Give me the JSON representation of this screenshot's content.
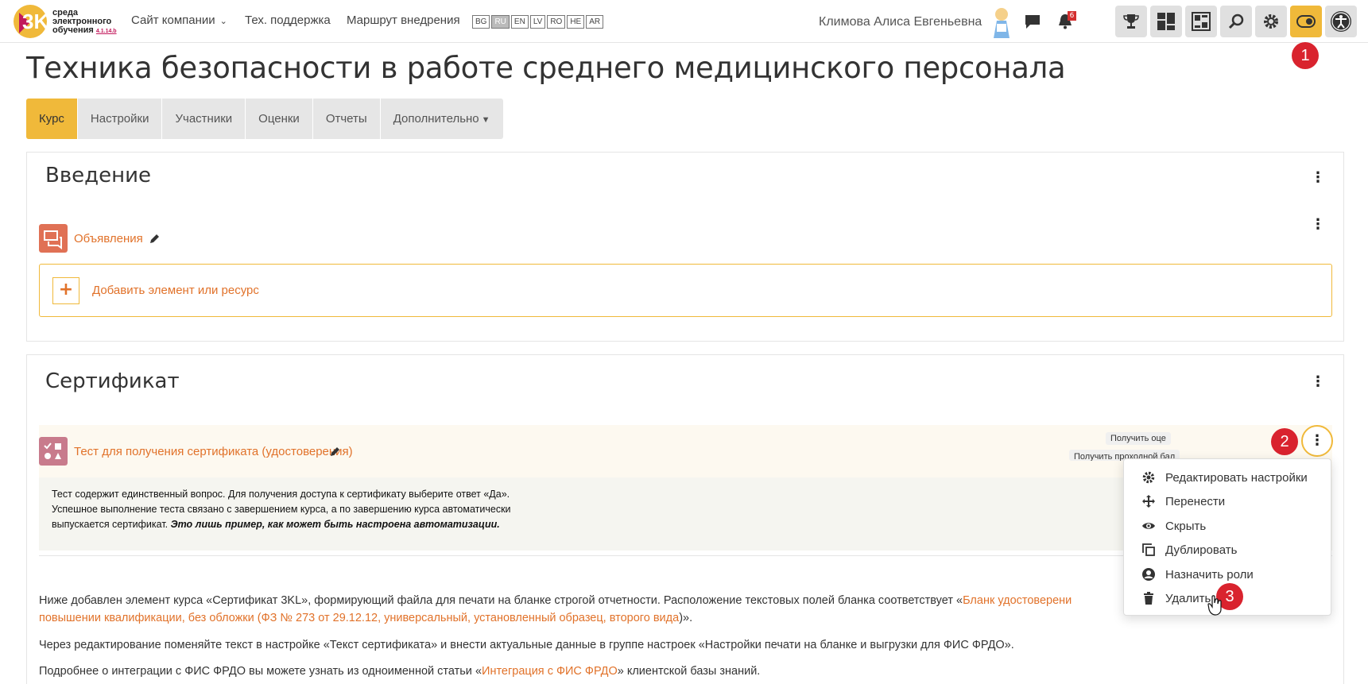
{
  "header": {
    "logo_number": "3K",
    "logo_text_1": "среда",
    "logo_text_2": "электронного",
    "logo_text_3": "обучения",
    "logo_version": "4.1.14.b",
    "nav_company": "Сайт компании",
    "nav_support": "Тех. поддержка",
    "nav_route": "Маршрут внедрения",
    "languages": [
      "BG",
      "RU",
      "EN",
      "LV",
      "RO",
      "HE",
      "AR"
    ],
    "active_language": "RU",
    "user_name": "Климова Алиса Евгеньевна",
    "notification_count": "6"
  },
  "callouts": {
    "one": "1",
    "two": "2",
    "three": "3"
  },
  "page": {
    "title": "Техника безопасности в работе среднего медицинского персонала"
  },
  "tabs": {
    "course": "Курс",
    "settings": "Настройки",
    "participants": "Участники",
    "grades": "Оценки",
    "reports": "Отчеты",
    "more": "Дополнительно"
  },
  "section_intro": {
    "title": "Введение",
    "activity_label": "Объявления",
    "add_label": "Добавить элемент или ресурс"
  },
  "section_cert": {
    "title": "Сертификат",
    "quiz_label": "Тест для получения сертификата (удостоверения)",
    "completion_1": "Получить оце",
    "completion_2": "Получить проходной бал",
    "desc_line_1": "Тест содержит единственный вопрос. Для получения доступа к сертификату выберите ответ «Да».",
    "desc_line_2": "Успешное выполнение теста связано с завершением курса, а по завершению курса автоматически",
    "desc_line_3_a": "выпускается сертификат. ",
    "desc_line_3_b": "Это лишь пример, как может быть настроена автоматизации.",
    "p1_a": "Ниже добавлен элемент курса «Сертификат 3KL», формирующий файла для печати на бланке строгой отчетности. Расположение текстовых полей бланка соответствует  «",
    "p1_link_a": "Бланк удостоверени",
    "p1_link_b": "повышении квалификации, без обложки (ФЗ № 273 от 29.12.12, универсальный, установленный образец, второго вида",
    "p1_end": ")».",
    "p2": "Через редактирование поменяйте текст в настройке «Текст сертификата» и внести актуальные данные в группе настроек «Настройки печати на бланке и выгрузки для ФИС ФРДО».",
    "p3_a": "Подробнее о интеграции с ФИС ФРДО вы можете узнать из одноименной статьи «",
    "p3_link": "Интеграция с ФИС ФРДО",
    "p3_b": "» клиентской базы знаний."
  },
  "dropdown": {
    "edit": "Редактировать настройки",
    "move": "Перенести",
    "hide": "Скрыть",
    "duplicate": "Дублировать",
    "roles": "Назначить роли",
    "delete": "Удалить"
  },
  "colors": {
    "accent": "#f0b93a",
    "link": "#e1722a",
    "badge": "#d9232e"
  }
}
